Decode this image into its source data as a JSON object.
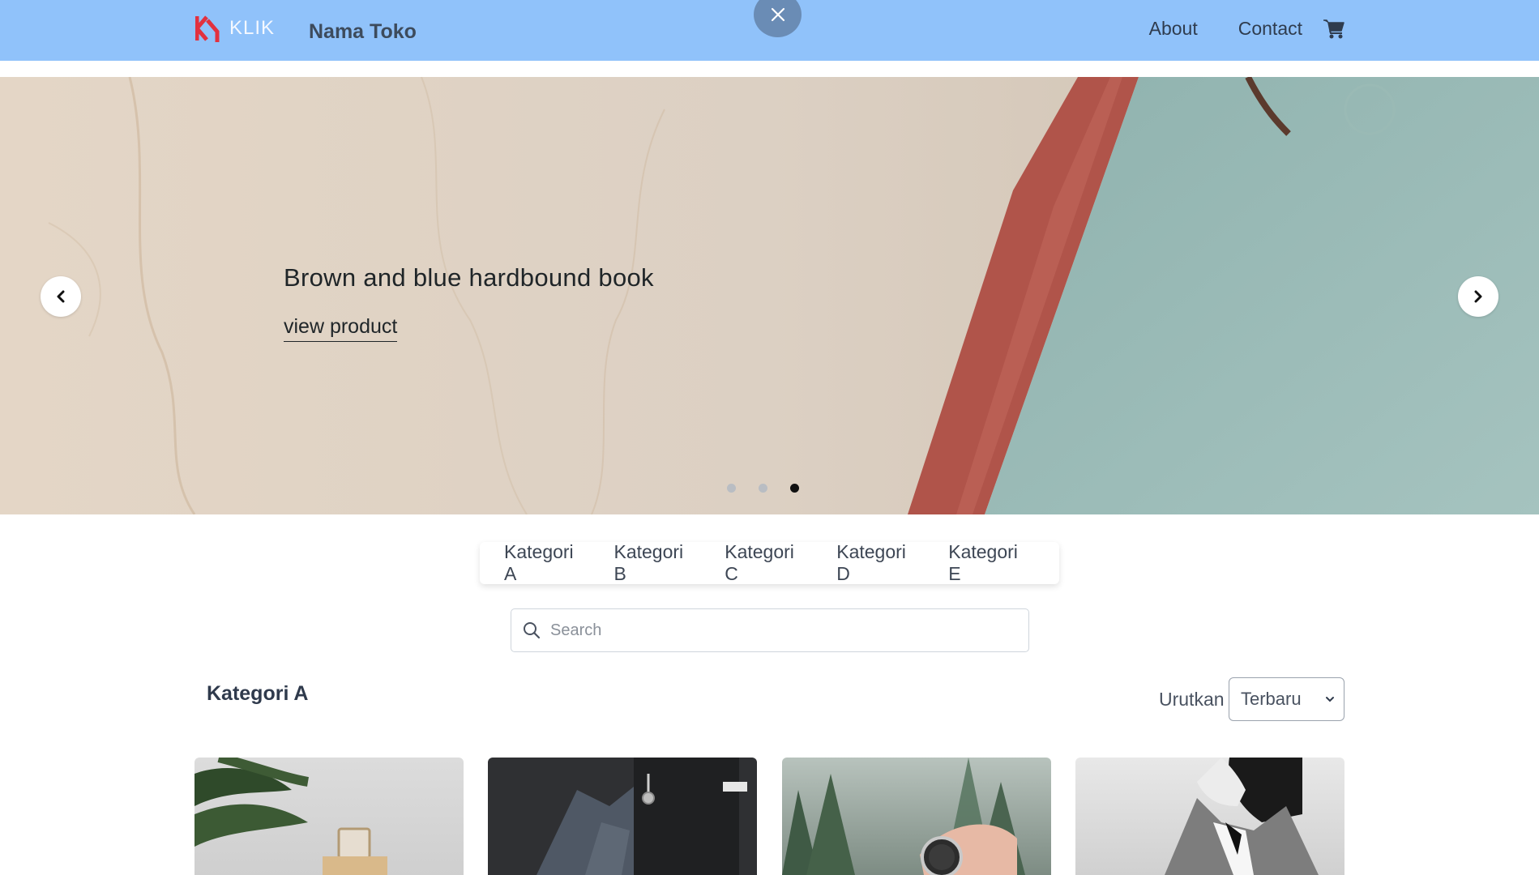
{
  "header": {
    "logo_text": "KLIK",
    "store_name": "Nama Toko",
    "nav": [
      {
        "label": "About"
      },
      {
        "label": "Contact"
      }
    ],
    "bg_color": "#90c2fa",
    "icons": {
      "close": "close-icon",
      "cart": "cart-icon"
    }
  },
  "hero": {
    "title": "Brown and blue hardbound book",
    "link_label": "view product",
    "slides": [
      {
        "active": false
      },
      {
        "active": false
      },
      {
        "active": true
      }
    ],
    "icons": {
      "prev": "chevron-left-icon",
      "next": "chevron-right-icon"
    }
  },
  "categories": [
    {
      "label": "Kategori A"
    },
    {
      "label": "Kategori B"
    },
    {
      "label": "Kategori C"
    },
    {
      "label": "Kategori D"
    },
    {
      "label": "Kategori E"
    }
  ],
  "search": {
    "placeholder": "Search",
    "value": ""
  },
  "section": {
    "title": "Kategori A",
    "sort_label": "Urutkan",
    "sort_selected": "Terbaru"
  },
  "products": [
    {
      "image": "perfume-bottle-with-leaves"
    },
    {
      "image": "folded-pants-and-watch"
    },
    {
      "image": "hand-holding-watch-forest"
    },
    {
      "image": "woman-in-plaid-blazer"
    }
  ]
}
